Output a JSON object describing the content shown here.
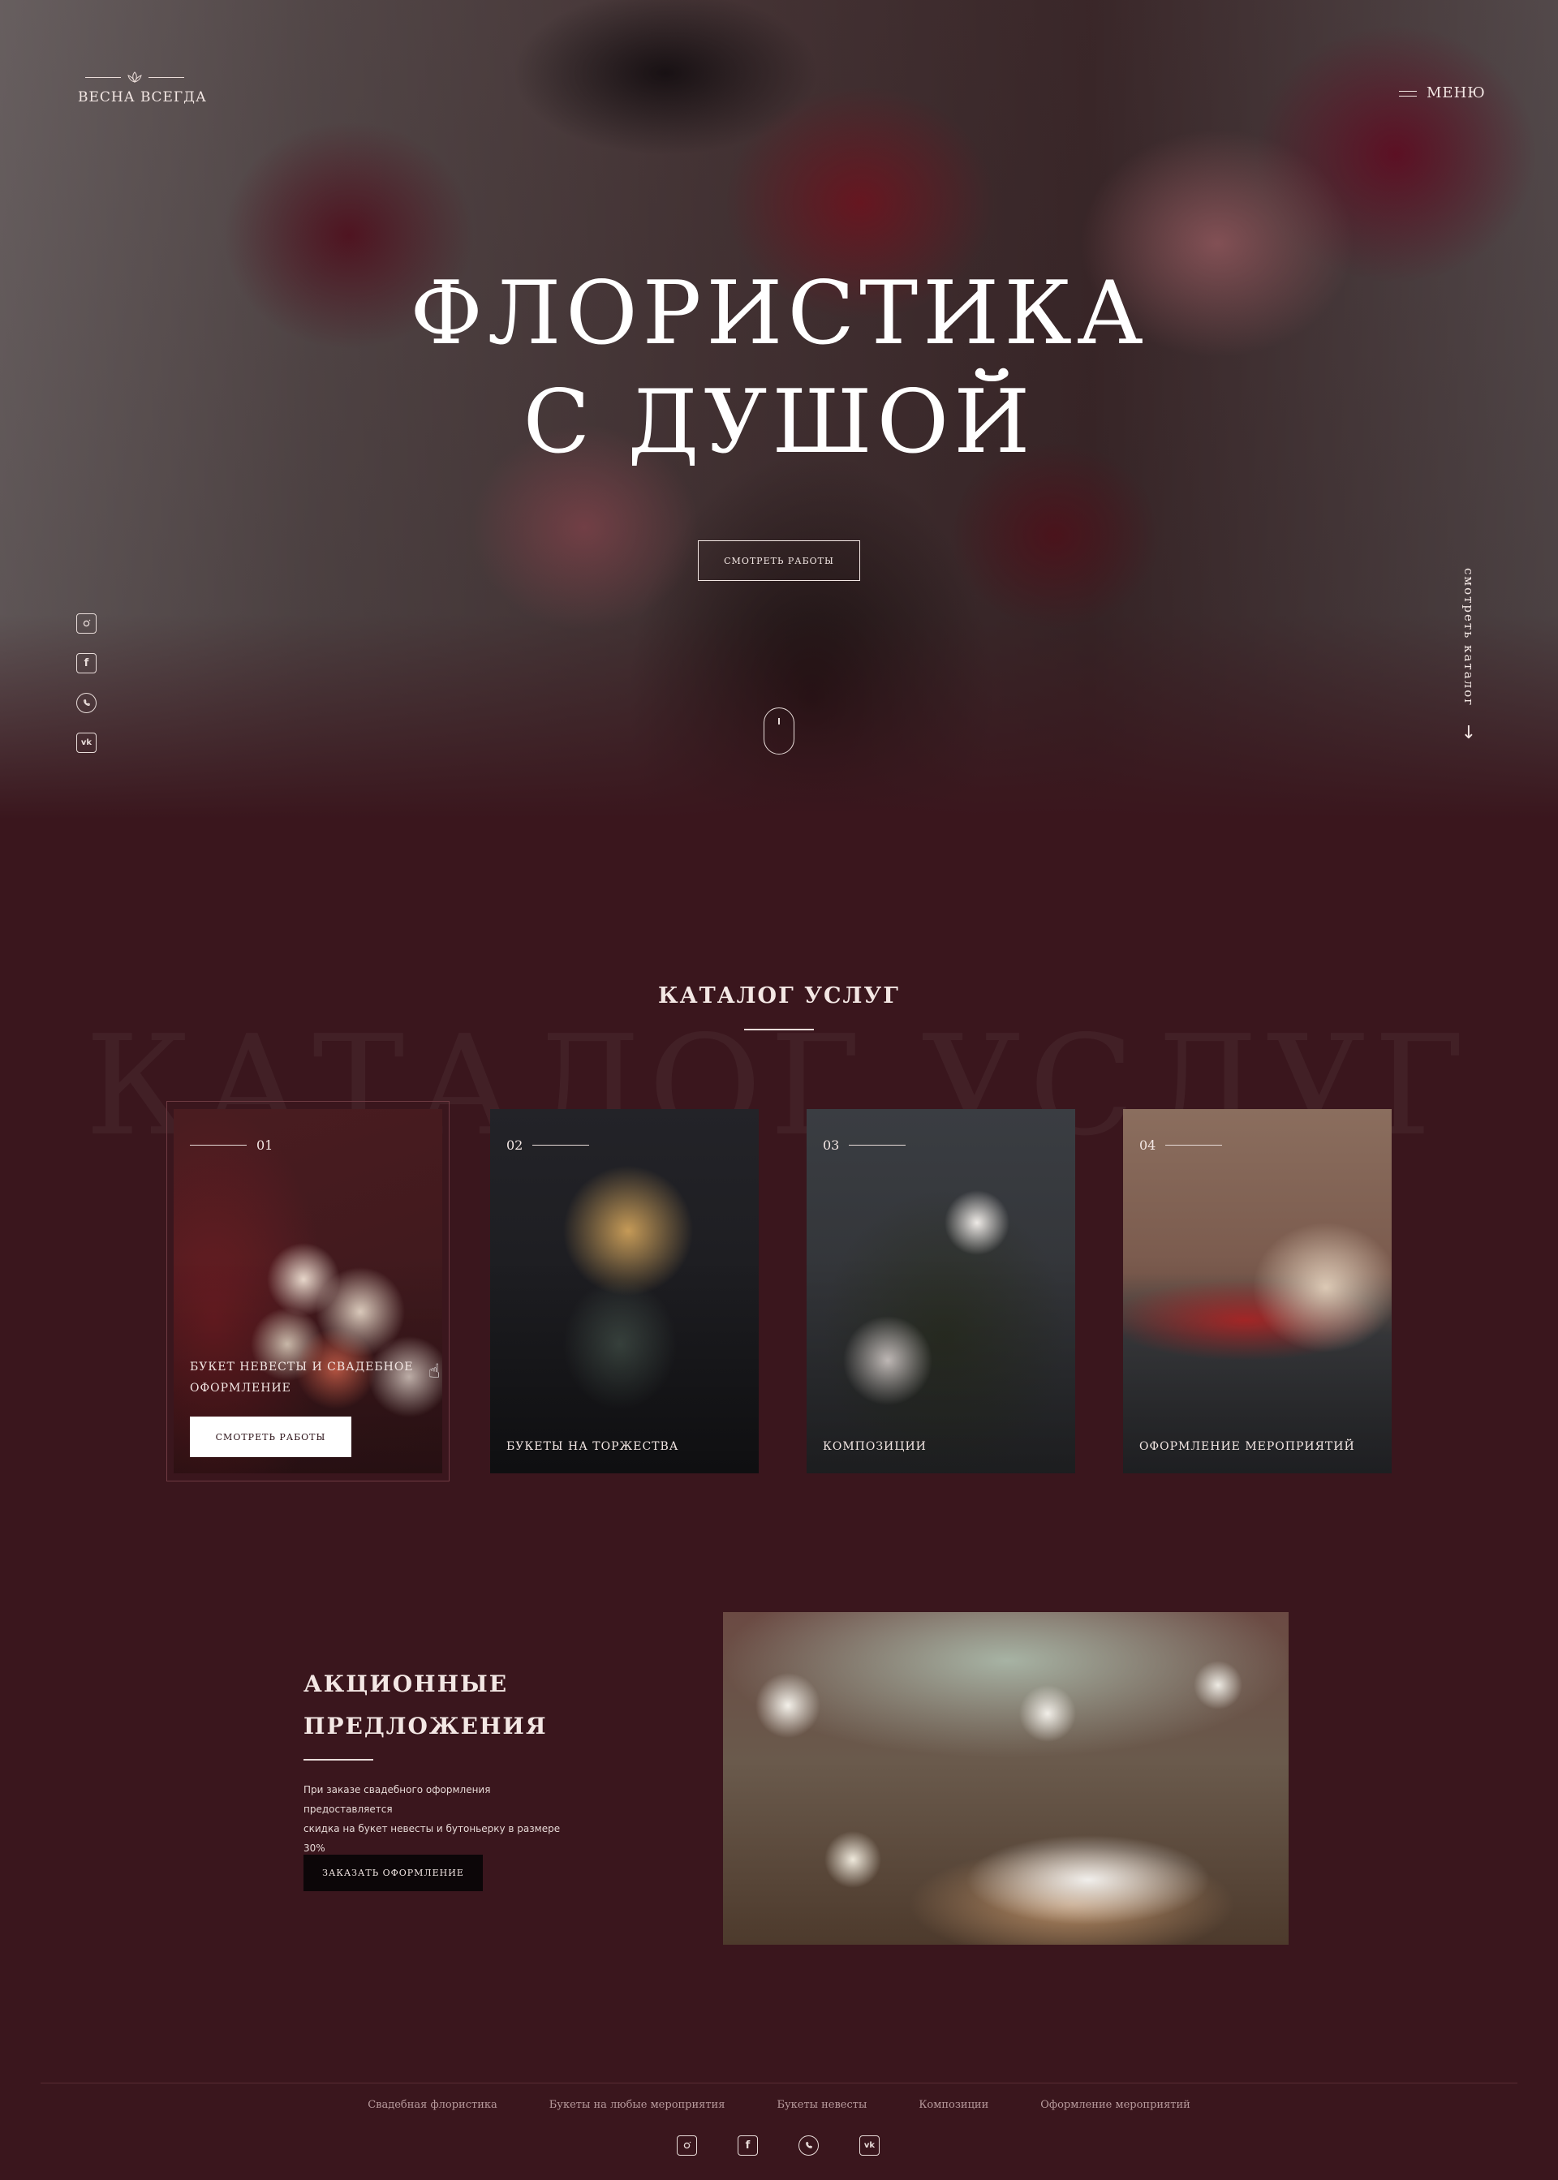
{
  "header": {
    "logo_text": "ВЕСНА ВСЕГДА",
    "menu_label": "МЕНЮ"
  },
  "hero": {
    "title_line1": "ФЛОРИСТИКА",
    "title_line2": "С ДУШОЙ",
    "button_label": "СМОТРЕТЬ РАБОТЫ",
    "catalog_link": "смотреть каталог",
    "socials": [
      "instagram-icon",
      "facebook-icon",
      "whatsapp-icon",
      "vk-icon"
    ]
  },
  "catalog": {
    "title": "КАТАЛОГ УСЛУГ",
    "ghost_title": "КАТАЛОГ УСЛУГ",
    "cards": [
      {
        "num": "01",
        "label": "БУКЕТ НЕВЕСТЫ И СВАДЕБНОЕ ОФОРМЛЕНИЕ",
        "button": "СМОТРЕТЬ РАБОТЫ"
      },
      {
        "num": "02",
        "label": "БУКЕТЫ НА ТОРЖЕСТВА"
      },
      {
        "num": "03",
        "label": "КОМПОЗИЦИИ"
      },
      {
        "num": "04",
        "label": "ОФОРМЛЕНИЕ МЕРОПРИЯТИЙ"
      }
    ]
  },
  "promo": {
    "title_line1": "АКЦИОННЫЕ",
    "title_line2": "ПРЕДЛОЖЕНИЯ",
    "text_line1": "При заказе свадебного оформления предоставляется",
    "text_line2": "скидка на букет невесты и бутоньерку в размере 30%",
    "button_label": "ЗАКАЗАТЬ ОФОРМЛЕНИЕ"
  },
  "footer": {
    "nav": [
      "Свадебная флористика",
      "Букеты на любые мероприятия",
      "Букеты невесты",
      "Композиции",
      "Оформление мероприятий"
    ],
    "socials": [
      "instagram-icon",
      "facebook-icon",
      "whatsapp-icon",
      "vk-icon"
    ]
  },
  "colors": {
    "background": "#3a161d",
    "text": "#f3e7e4",
    "promo_button": "#0c0608",
    "card_button": "#ffffff"
  }
}
